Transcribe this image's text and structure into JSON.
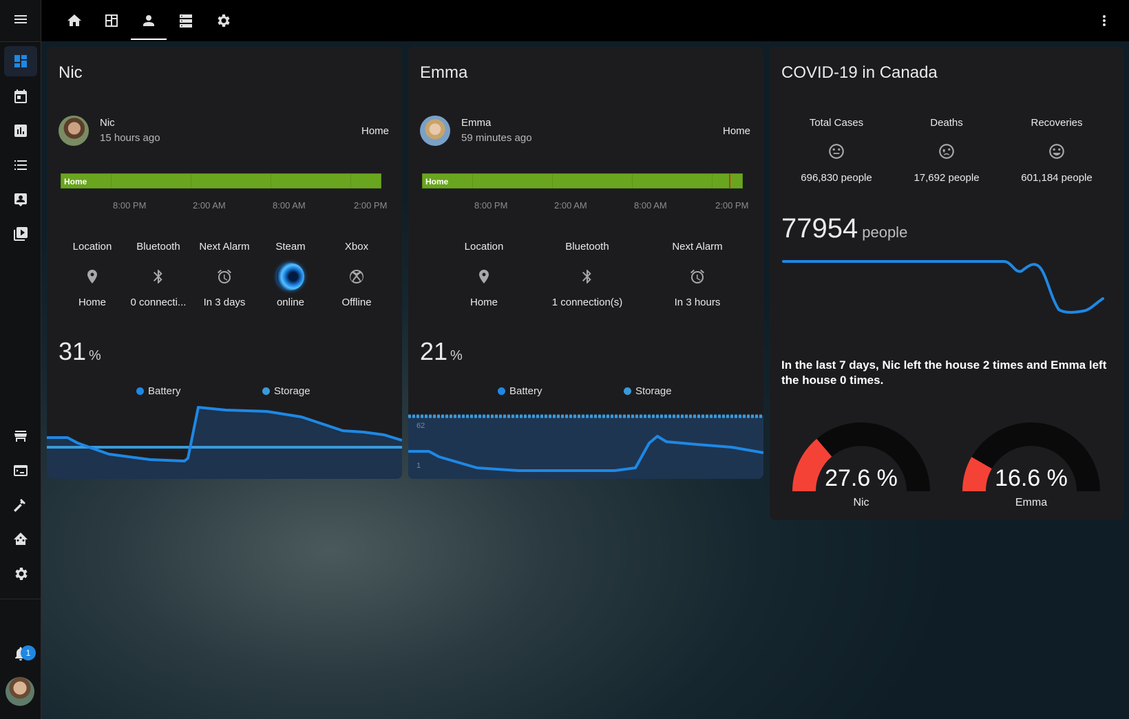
{
  "top_tabs": [
    "home-icon",
    "dashboard-view-icon",
    "person-icon",
    "server-icon",
    "gear-icon"
  ],
  "cards": {
    "nic": {
      "title": "Nic",
      "person": {
        "name": "Nic",
        "time": "15 hours ago",
        "state": "Home"
      },
      "timeline": {
        "label": "Home",
        "ticks": [
          "8:00 PM",
          "2:00 AM",
          "8:00 AM",
          "2:00 PM"
        ]
      },
      "entities": [
        {
          "label": "Location",
          "icon": "map-marker-icon",
          "value": "Home"
        },
        {
          "label": "Bluetooth",
          "icon": "bluetooth-icon",
          "value": "0 connecti..."
        },
        {
          "label": "Next Alarm",
          "icon": "alarm-clock-icon",
          "value": "In 3 days"
        },
        {
          "label": "Steam",
          "icon": "steam-avatar-icon",
          "value": "online"
        },
        {
          "label": "Xbox",
          "icon": "xbox-icon",
          "value": "Offline"
        }
      ],
      "battery": {
        "value": "31",
        "unit": "%"
      },
      "legend": {
        "battery": "Battery",
        "storage": "Storage"
      }
    },
    "emma": {
      "title": "Emma",
      "person": {
        "name": "Emma",
        "time": "59 minutes ago",
        "state": "Home"
      },
      "timeline": {
        "label": "Home",
        "ticks": [
          "8:00 PM",
          "2:00 AM",
          "8:00 AM",
          "2:00 PM"
        ]
      },
      "entities": [
        {
          "label": "Location",
          "icon": "map-marker-icon",
          "value": "Home"
        },
        {
          "label": "Bluetooth",
          "icon": "bluetooth-icon",
          "value": "1 connection(s)"
        },
        {
          "label": "Next Alarm",
          "icon": "alarm-clock-icon",
          "value": "In 3 hours"
        }
      ],
      "battery": {
        "value": "21",
        "unit": "%"
      },
      "legend": {
        "battery": "Battery",
        "storage": "Storage"
      },
      "graph_labels": {
        "top": "62",
        "bottom": "1"
      }
    },
    "covid": {
      "title": "COVID-19 in Canada",
      "stats": [
        {
          "label": "Total Cases",
          "icon": "emoticon-neutral-icon",
          "value": "696,830 people"
        },
        {
          "label": "Deaths",
          "icon": "emoticon-cry-icon",
          "value": "17,692 people"
        },
        {
          "label": "Recoveries",
          "icon": "emoticon-happy-icon",
          "value": "601,184 people"
        }
      ],
      "active": {
        "value": "77954",
        "unit": "people"
      },
      "summary": "In the last 7 days, Nic left the house 2 times and Emma left the house 0 times.",
      "gauges": [
        {
          "value": "27.6 %",
          "fraction": 0.276,
          "name": "Nic"
        },
        {
          "value": "16.6 %",
          "fraction": 0.166,
          "name": "Emma"
        }
      ]
    }
  },
  "notifications": {
    "count": "1"
  },
  "colors": {
    "accent": "#1e88e5",
    "timeline_green": "#6aa51f",
    "gauge_red": "#f44336",
    "card_bg": "#1c1c1f"
  }
}
